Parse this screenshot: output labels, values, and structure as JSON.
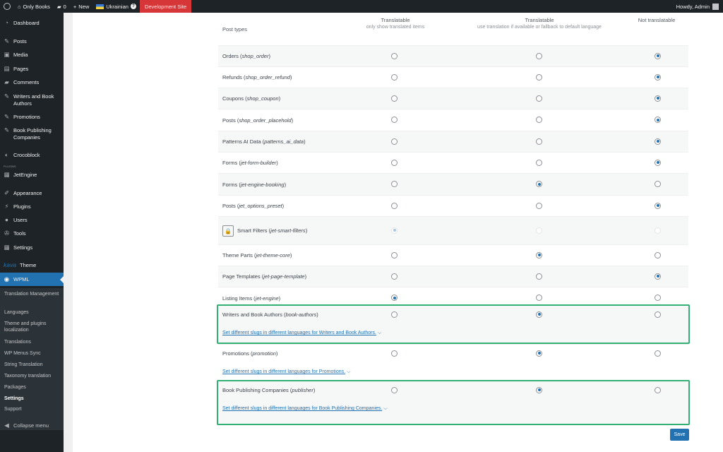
{
  "adminbar": {
    "site_name": "Only Books",
    "comments_count": "0",
    "new_label": "New",
    "language": "Ukrainian",
    "language_badge": "?",
    "dev_site_label": "Development Site",
    "howdy": "Howdy, Admin"
  },
  "sidebar": {
    "items": [
      {
        "label": "Dashboard",
        "icon": "dashboard-icon",
        "glyph": "◔"
      },
      {
        "label": "Posts",
        "icon": "pin-icon",
        "glyph": "✎"
      },
      {
        "label": "Media",
        "icon": "media-icon",
        "glyph": "▣"
      },
      {
        "label": "Pages",
        "icon": "pages-icon",
        "glyph": "▤"
      },
      {
        "label": "Comments",
        "icon": "comments-icon",
        "glyph": "▰"
      },
      {
        "label": "Writers and Book Authors",
        "icon": "pin-icon",
        "glyph": "✎"
      },
      {
        "label": "Promotions",
        "icon": "pin-icon",
        "glyph": "✎"
      },
      {
        "label": "Book Publishing Companies",
        "icon": "pin-icon",
        "glyph": "✎"
      },
      {
        "label": "Crocoblock",
        "icon": "crocoblock-icon",
        "glyph": "◐"
      },
      {
        "label": "JetEngine",
        "icon": "jetengine-icon",
        "glyph": "▦"
      },
      {
        "label": "Appearance",
        "icon": "appearance-icon",
        "glyph": "✐"
      },
      {
        "label": "Plugins",
        "icon": "plugins-icon",
        "glyph": "⚡"
      },
      {
        "label": "Users",
        "icon": "users-icon",
        "glyph": "●"
      },
      {
        "label": "Tools",
        "icon": "tools-icon",
        "glyph": "✇"
      },
      {
        "label": "Settings",
        "icon": "settings-icon",
        "glyph": "▦"
      },
      {
        "label": "Theme",
        "icon": "theme-brand-icon",
        "glyph": "kava"
      },
      {
        "label": "WPML",
        "icon": "wpml-icon",
        "glyph": "◉"
      }
    ],
    "plugins_sep": "PLUGINS",
    "submenu": [
      "Translation Management",
      "Languages",
      "Theme and plugins localization",
      "Translations",
      "WP Menus Sync",
      "String Translation",
      "Taxonomy translation",
      "Packages",
      "Settings",
      "Support"
    ],
    "collapse_label": "Collapse menu"
  },
  "table": {
    "header_post_types": "Post types",
    "col1_title": "Translatable",
    "col1_sub": "only show translated items",
    "col2_title": "Translatable",
    "col2_sub": "use translation if available or fallback to default language",
    "col3_title": "Not translatable",
    "rows": [
      {
        "name": "Orders",
        "slug": "shop_order",
        "selected": 3
      },
      {
        "name": "Refunds",
        "slug": "shop_order_refund",
        "selected": 3
      },
      {
        "name": "Coupons",
        "slug": "shop_coupon",
        "selected": 3
      },
      {
        "name": "Posts",
        "slug": "shop_order_placehold",
        "selected": 3
      },
      {
        "name": "Patterns AI Data",
        "slug": "patterns_ai_data",
        "selected": 3
      },
      {
        "name": "Forms",
        "slug": "jet-form-builder",
        "selected": 3
      },
      {
        "name": "Forms",
        "slug": "jet-engine-booking",
        "selected": 2
      },
      {
        "name": "Posts",
        "slug": "jet_options_preset",
        "selected": 3
      },
      {
        "name": "Smart Filters",
        "slug": "jet-smart-filters",
        "selected": 1,
        "locked": true
      },
      {
        "name": "Theme Parts",
        "slug": "jet-theme-core",
        "selected": 2
      },
      {
        "name": "Page Templates",
        "slug": "jet-page-template",
        "selected": 3
      },
      {
        "name": "Listing Items",
        "slug": "jet-engine",
        "selected": 1
      },
      {
        "name": "Writers and Book Authors",
        "slug": "book-authors",
        "selected": 2,
        "link": "Set different slugs in different languages for Writers and Book Authors."
      },
      {
        "name": "Promotions",
        "slug": "promotion",
        "selected": 2,
        "link": "Set different slugs in different languages for Promotions."
      },
      {
        "name": "Book Publishing Companies",
        "slug": "publisher",
        "selected": 2,
        "link": "Set different slugs in different languages for Book Publishing Companies."
      }
    ]
  },
  "save_label": "Save",
  "colors": {
    "accent": "#2271b1",
    "highlight": "#33b073",
    "adminbar": "#1d2327",
    "devsite": "#d63638"
  }
}
